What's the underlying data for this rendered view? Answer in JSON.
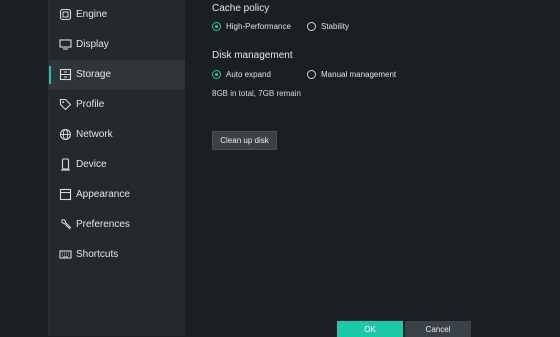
{
  "sidebar": {
    "items": [
      {
        "label": "Engine",
        "icon": "engine-icon"
      },
      {
        "label": "Display",
        "icon": "monitor-icon"
      },
      {
        "label": "Storage",
        "icon": "storage-icon",
        "active": true
      },
      {
        "label": "Profile",
        "icon": "tag-icon"
      },
      {
        "label": "Network",
        "icon": "globe-icon"
      },
      {
        "label": "Device",
        "icon": "phone-icon"
      },
      {
        "label": "Appearance",
        "icon": "window-icon"
      },
      {
        "label": "Preferences",
        "icon": "wrench-icon"
      },
      {
        "label": "Shortcuts",
        "icon": "keyboard-icon"
      }
    ]
  },
  "main": {
    "cache_policy": {
      "title": "Cache policy",
      "options": [
        "High-Performance",
        "Stability"
      ],
      "selected": "High-Performance"
    },
    "disk_management": {
      "title": "Disk management",
      "options": [
        "Auto expand",
        "Manual management"
      ],
      "selected": "Auto expand",
      "info": "8GB in total, 7GB remain"
    },
    "cleanup_label": "Clean up disk"
  },
  "footer": {
    "ok_label": "OK",
    "cancel_label": "Cancel"
  },
  "colors": {
    "accent": "#1bc8a8",
    "background": "#1c1f22",
    "sidebar": "#25292d"
  }
}
